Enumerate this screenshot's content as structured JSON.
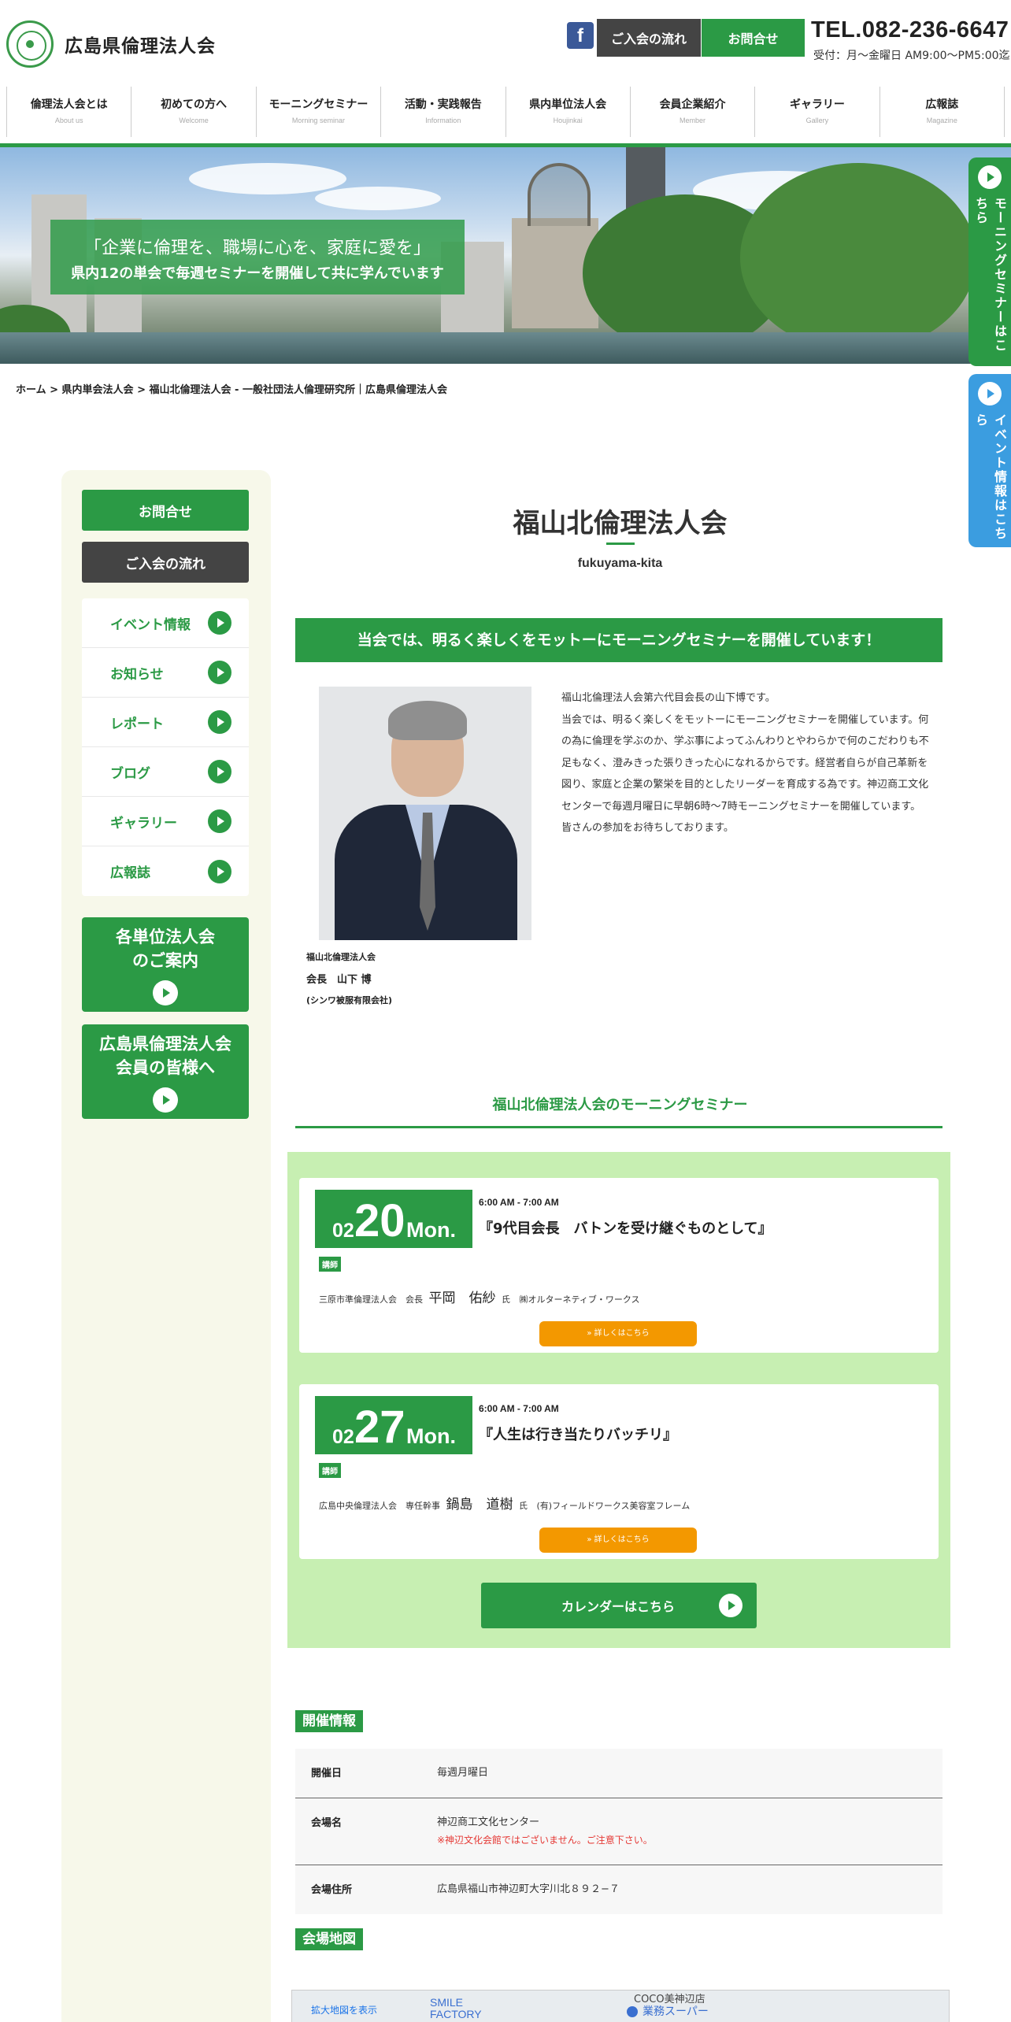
{
  "header": {
    "logo_text": "広島県倫理法人会",
    "fb_label": "f",
    "join_button": "ご入会の流れ",
    "contact_button": "お問合せ",
    "tel": "TEL.082-236-6647",
    "hours": "受付：月〜金曜日 AM9:00〜PM5:00迄"
  },
  "nav": [
    {
      "jp": "倫理法人会とは",
      "en": "About us"
    },
    {
      "jp": "初めての方へ",
      "en": "Welcome"
    },
    {
      "jp": "モーニングセミナー",
      "en": "Morning seminar"
    },
    {
      "jp": "活動・実践報告",
      "en": "Information"
    },
    {
      "jp": "県内単位法人会",
      "en": "Houjinkai"
    },
    {
      "jp": "会員企業紹介",
      "en": "Member"
    },
    {
      "jp": "ギャラリー",
      "en": "Gallery"
    },
    {
      "jp": "広報誌",
      "en": "Magazine"
    }
  ],
  "hero": {
    "line1": "「企業に倫理を、職場に心を、家庭に愛を」",
    "line2": "県内12の単会で毎週セミナーを開催して共に学んでいます"
  },
  "sidetabs": {
    "seminar": "モーニングセミナーはこちら",
    "event": "イベント情報はこちら"
  },
  "breadcrumb": "ホーム > 県内単会法人会 > 福山北倫理法人会 - 一般社団法人倫理研究所｜広島県倫理法人会",
  "sidebar": {
    "contact": "お問合せ",
    "join": "ご入会の流れ",
    "items": [
      {
        "label": "イベント情報"
      },
      {
        "label": "お知らせ"
      },
      {
        "label": "レポート"
      },
      {
        "label": "ブログ"
      },
      {
        "label": "ギャラリー"
      },
      {
        "label": "広報誌"
      }
    ],
    "big1_line1": "各単位法人会",
    "big1_line2": "のご案内",
    "big2_line1": "広島県倫理法人会",
    "big2_line2": "会員の皆様へ"
  },
  "main": {
    "title": "福山北倫理法人会",
    "subtitle": "fukuyama-kita",
    "motto": "当会では、明るく楽しくをモットーにモーニングセミナーを開催しています！",
    "caption_org": "福山北倫理法人会",
    "caption_name": "会長　山下 博",
    "caption_company": "(シンワ被服有限会社)",
    "intro": [
      "福山北倫理法人会第六代目会長の山下博です。",
      "当会では、明るく楽しくをモットーにモーニングセミナーを開催しています。何の為に倫理を学ぶのか、学ぶ事によってふんわりとやわらかで何のこだわりも不足もなく、澄みきった張りきった心になれるからです。経営者自らが自己革新を図り、家庭と企業の繁栄を目的としたリーダーを育成する為です。神辺商工文化センターで毎週月曜日に早朝6時〜7時モーニングセミナーを開催しています。",
      "皆さんの参加をお待ちしております。"
    ],
    "seminar_title": "福山北倫理法人会のモーニングセミナー",
    "seminars": [
      {
        "month": "02",
        "day": "20",
        "weekday": "Mon.",
        "time": "6:00 AM - 7:00 AM",
        "topic": "『9代目会長　バトンを受け継ぐものとして』",
        "badge": "講師",
        "org": "三原市準倫理法人会　会長",
        "name": "平岡　佑紗",
        "suffix": "氏",
        "company": "㈱オルターネティブ・ワークス",
        "button": "» 詳しくはこちら"
      },
      {
        "month": "02",
        "day": "27",
        "weekday": "Mon.",
        "time": "6:00 AM - 7:00 AM",
        "topic": "『人生は行き当たりバッチリ』",
        "badge": "講師",
        "org": "広島中央倫理法人会　専任幹事",
        "name": "鍋島　道樹",
        "suffix": "氏",
        "company": "(有)フィールドワークス美容室フレーム",
        "button": "» 詳しくはこちら"
      }
    ],
    "calendar_button": "カレンダーはこちら",
    "info_heading": "開催情報",
    "info": [
      {
        "key": "開催日",
        "value": "毎週月曜日",
        "note": ""
      },
      {
        "key": "会場名",
        "value": "神辺商工文化センター",
        "note": "※神辺文化会館ではございません。ご注意下さい。"
      },
      {
        "key": "会場住所",
        "value": "広島県福山市神辺町大字川北８９２−７",
        "note": ""
      }
    ],
    "map_heading": "会場地図",
    "map": {
      "link": "拡大地図を表示",
      "place1": "SMILE FACTORY PHOTO STUDIO",
      "place2": "COCO美神辺店",
      "place3": "業務スーパー"
    }
  },
  "colors": {
    "accent": "#2b9a45",
    "dark": "#444444",
    "panel": "#c7efb2",
    "orange": "#f39800"
  }
}
